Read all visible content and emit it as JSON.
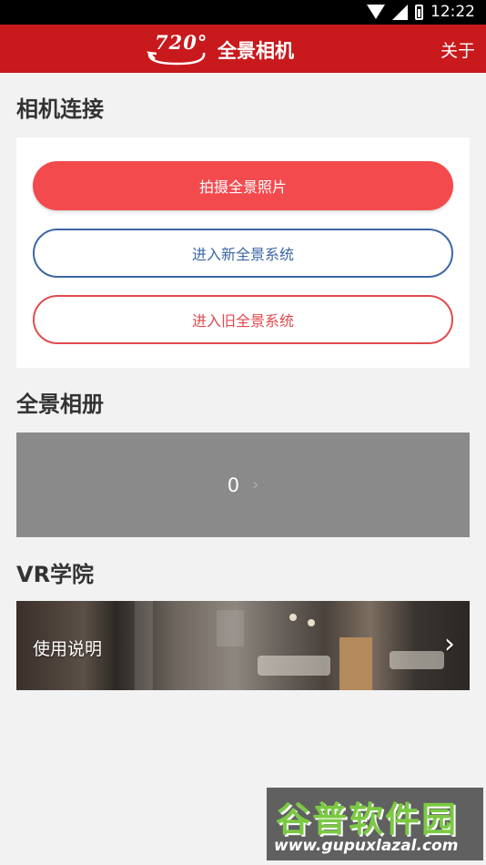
{
  "status_bar": {
    "time": "12:22",
    "icons": [
      "wifi-icon",
      "signal-icon",
      "battery-icon"
    ]
  },
  "header": {
    "logo_text": "720°",
    "title": "全景相机",
    "about_label": "关于",
    "color": "#c8191c"
  },
  "camera_connection": {
    "title": "相机连接",
    "take_photo_label": "拍摄全景照片",
    "new_system_label": "进入新全景系统",
    "old_system_label": "进入旧全景系统"
  },
  "album": {
    "title": "全景相册",
    "count": "0",
    "chevron_icon": "chevron-right-icon"
  },
  "vr_academy": {
    "title": "VR学院",
    "banner_label": "使用说明",
    "chevron_icon": "chevron-right-icon"
  },
  "watermark": {
    "main": "谷普软件园",
    "url": "www.gupuxlazal.com"
  },
  "colors": {
    "primary_red": "#f34a4e",
    "blue_outline": "#3d66a5",
    "red_outline": "#e04a4e",
    "background": "#f2f2f2"
  }
}
